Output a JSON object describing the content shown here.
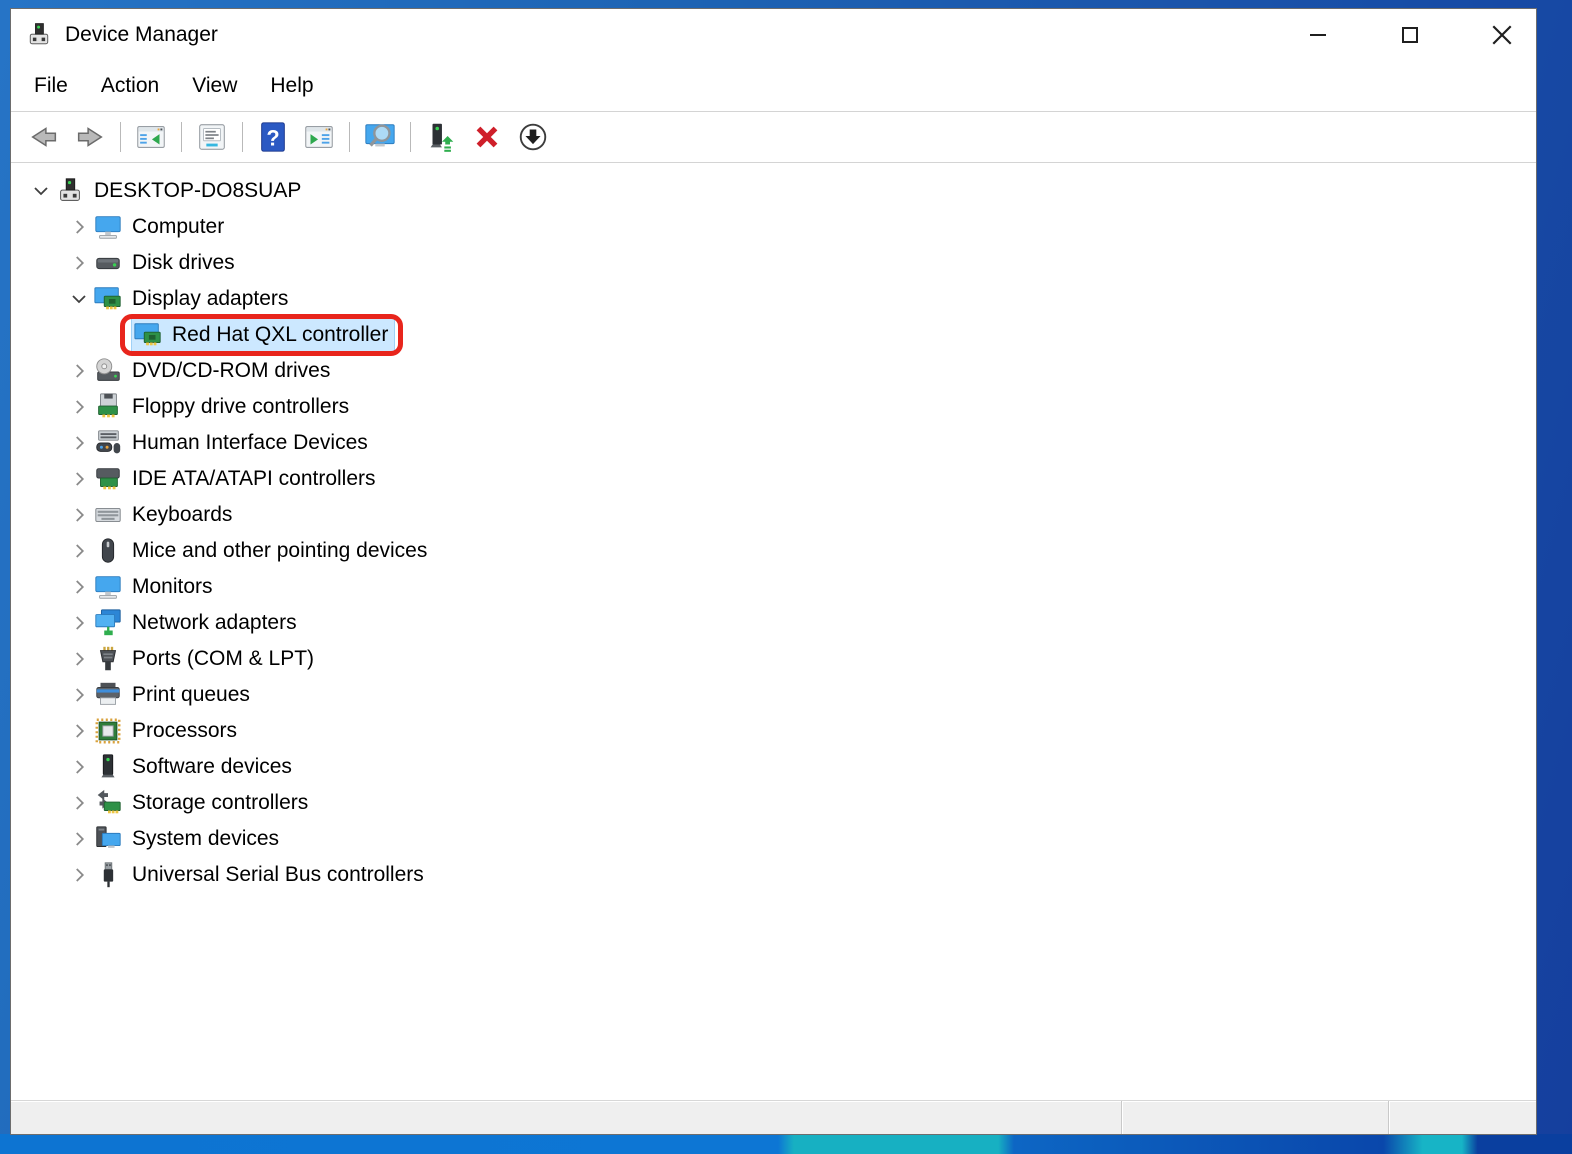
{
  "window": {
    "title": "Device Manager",
    "controls": [
      {
        "name": "minimize"
      },
      {
        "name": "maximize"
      },
      {
        "name": "close"
      }
    ]
  },
  "menu_bar": {
    "items": [
      {
        "label": "File"
      },
      {
        "label": "Action"
      },
      {
        "label": "View"
      },
      {
        "label": "Help"
      }
    ]
  },
  "toolbar": {
    "buttons": [
      {
        "icon": "back-icon"
      },
      {
        "icon": "forward-icon"
      },
      {
        "icon": "show-console-tree-icon"
      },
      {
        "icon": "properties-icon"
      },
      {
        "icon": "help-icon"
      },
      {
        "icon": "show-action-pane-icon"
      },
      {
        "icon": "scan-hardware-changes-icon"
      },
      {
        "icon": "update-driver-icon"
      },
      {
        "icon": "uninstall-device-icon"
      },
      {
        "icon": "disable-device-icon"
      }
    ]
  },
  "tree": {
    "rows": [
      {
        "label": "DESKTOP-DO8SUAP",
        "level": 0,
        "state": "expanded",
        "icon": "computer-device-icon",
        "selected": false
      },
      {
        "label": "Computer",
        "level": 1,
        "state": "collapsed",
        "icon": "monitor-icon",
        "selected": false
      },
      {
        "label": "Disk drives",
        "level": 1,
        "state": "collapsed",
        "icon": "disk-drive-icon",
        "selected": false
      },
      {
        "label": "Display adapters",
        "level": 1,
        "state": "expanded",
        "icon": "display-adapter-icon",
        "selected": false
      },
      {
        "label": "Red Hat QXL controller",
        "level": 2,
        "state": "leaf",
        "icon": "display-adapter-icon",
        "selected": true,
        "annotated": true
      },
      {
        "label": "DVD/CD-ROM drives",
        "level": 1,
        "state": "collapsed",
        "icon": "dvd-drive-icon",
        "selected": false
      },
      {
        "label": "Floppy drive controllers",
        "level": 1,
        "state": "collapsed",
        "icon": "floppy-controller-icon",
        "selected": false
      },
      {
        "label": "Human Interface Devices",
        "level": 1,
        "state": "collapsed",
        "icon": "hid-icon",
        "selected": false
      },
      {
        "label": "IDE ATA/ATAPI controllers",
        "level": 1,
        "state": "collapsed",
        "icon": "ide-controller-icon",
        "selected": false
      },
      {
        "label": "Keyboards",
        "level": 1,
        "state": "collapsed",
        "icon": "keyboard-icon",
        "selected": false
      },
      {
        "label": "Mice and other pointing devices",
        "level": 1,
        "state": "collapsed",
        "icon": "mouse-icon",
        "selected": false
      },
      {
        "label": "Monitors",
        "level": 1,
        "state": "collapsed",
        "icon": "monitors-icon",
        "selected": false
      },
      {
        "label": "Network adapters",
        "level": 1,
        "state": "collapsed",
        "icon": "network-adapter-icon",
        "selected": false
      },
      {
        "label": "Ports (COM & LPT)",
        "level": 1,
        "state": "collapsed",
        "icon": "ports-icon",
        "selected": false
      },
      {
        "label": "Print queues",
        "level": 1,
        "state": "collapsed",
        "icon": "printer-icon",
        "selected": false
      },
      {
        "label": "Processors",
        "level": 1,
        "state": "collapsed",
        "icon": "processor-icon",
        "selected": false
      },
      {
        "label": "Software devices",
        "level": 1,
        "state": "collapsed",
        "icon": "software-device-icon",
        "selected": false
      },
      {
        "label": "Storage controllers",
        "level": 1,
        "state": "collapsed",
        "icon": "storage-controller-icon",
        "selected": false
      },
      {
        "label": "System devices",
        "level": 1,
        "state": "collapsed",
        "icon": "system-device-icon",
        "selected": false
      },
      {
        "label": "Universal Serial Bus controllers",
        "level": 1,
        "state": "collapsed",
        "icon": "usb-icon",
        "selected": false
      }
    ]
  },
  "status_bar": {
    "sections": [
      "",
      "",
      ""
    ]
  },
  "colors": {
    "selection_bg": "#cce8ff",
    "selection_border": "#9fd1f7",
    "annotation_red": "#e8251c",
    "desktop_blue": "#1d64b4",
    "statusbar_bg": "#efefef"
  }
}
